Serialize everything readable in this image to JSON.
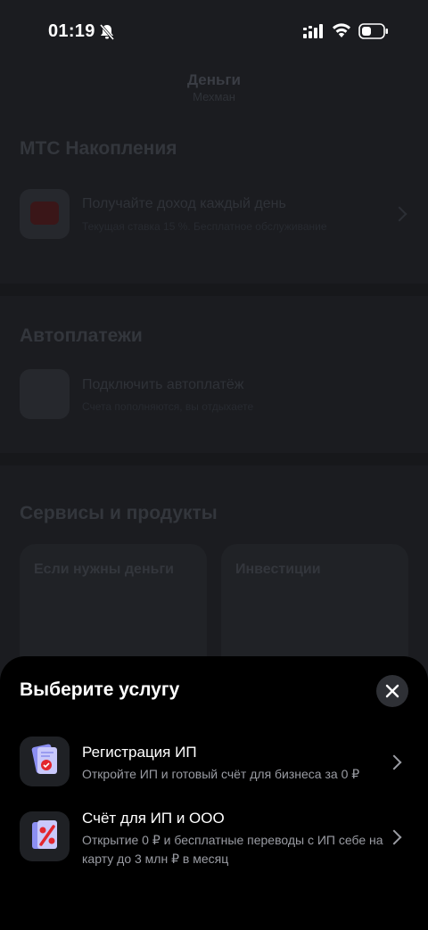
{
  "status_bar": {
    "time": "01:19"
  },
  "background": {
    "title": "Деньги",
    "subtitle": "Мехман",
    "savings": {
      "heading": "МТС Накопления",
      "row_title": "Получайте доход каждый день",
      "row_sub": "Текущая ставка 15 %. Бесплатное обслуживание"
    },
    "autopay": {
      "heading": "Автоплатежи",
      "row_title": "Подключить автоплатёж",
      "row_sub": "Счета пополняются, вы отдыхаете"
    },
    "services": {
      "heading": "Сервисы и продукты",
      "cards": [
        "Если нужны деньги",
        "Инвестиции"
      ]
    }
  },
  "sheet": {
    "title": "Выберите услугу",
    "options": [
      {
        "title": "Регистрация ИП",
        "sub": "Откройте ИП и готовый счёт для бизнеса за 0 ₽"
      },
      {
        "title": "Счёт для ИП и ООО",
        "sub": "Открытие 0 ₽ и бесплатные переводы с ИП себе на карту до 3 млн ₽ в месяц"
      }
    ]
  },
  "colors": {
    "sheet_bg": "#000000",
    "page_bg": "#1b1c20",
    "accent": "#e3262e"
  }
}
